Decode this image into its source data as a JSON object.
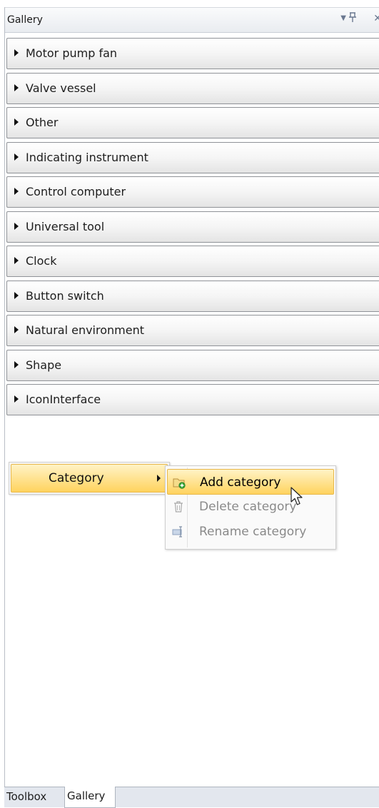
{
  "panel": {
    "title": "Gallery",
    "controls": {
      "dropdown_icon": "dropdown-icon",
      "pin_icon": "pin-icon",
      "close_icon": "close-icon"
    }
  },
  "categories": [
    {
      "label": "Motor pump fan"
    },
    {
      "label": "Valve vessel"
    },
    {
      "label": "Other"
    },
    {
      "label": "Indicating instrument"
    },
    {
      "label": "Control computer"
    },
    {
      "label": "Universal tool"
    },
    {
      "label": "Clock"
    },
    {
      "label": "Button switch"
    },
    {
      "label": "Natural environment"
    },
    {
      "label": "Shape"
    },
    {
      "label": "IconInterface"
    }
  ],
  "context_menu": {
    "item_label": "Category",
    "submenu": [
      {
        "label": "Add category",
        "icon": "add-category-icon",
        "enabled": true,
        "highlighted": true
      },
      {
        "label": "Delete category",
        "icon": "trash-icon",
        "enabled": false,
        "highlighted": false
      },
      {
        "label": "Rename category",
        "icon": "rename-icon",
        "enabled": false,
        "highlighted": false
      }
    ]
  },
  "tabs": [
    {
      "label": "Toolbox",
      "active": false
    },
    {
      "label": "Gallery",
      "active": true
    }
  ],
  "colors": {
    "highlight_top": "#fff3c6",
    "highlight_bottom": "#ffd35e",
    "highlight_border": "#e8b84a"
  }
}
